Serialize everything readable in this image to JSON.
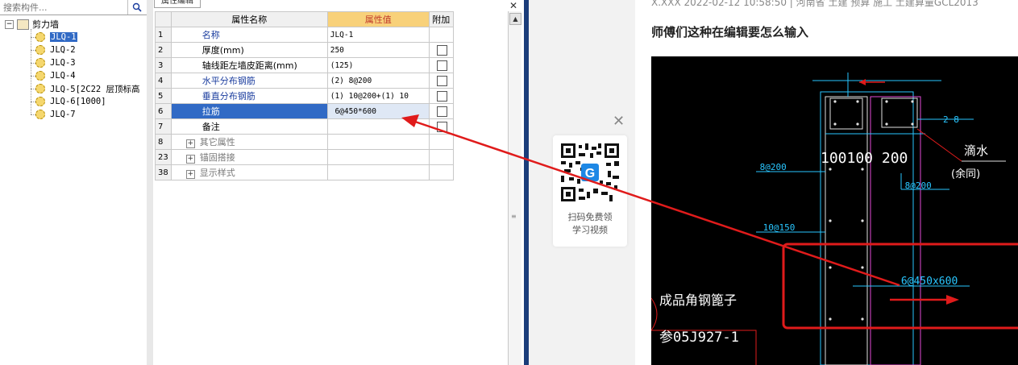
{
  "search": {
    "placeholder": "搜索构件...",
    "icon": "search-icon"
  },
  "tree": {
    "root_label": "剪力墙",
    "items": [
      {
        "label": "JLQ-1",
        "selected": true
      },
      {
        "label": "JLQ-2"
      },
      {
        "label": "JLQ-3"
      },
      {
        "label": "JLQ-4"
      },
      {
        "label": "JLQ-5[2C22 层顶标高"
      },
      {
        "label": "JLQ-6[1000]"
      },
      {
        "label": "JLQ-7"
      }
    ]
  },
  "prop_editor": {
    "tab_label": "属性编辑",
    "headers": {
      "name": "属性名称",
      "value": "属性值",
      "extra": "附加"
    },
    "rows": [
      {
        "num": "1",
        "name": "名称",
        "value": "JLQ-1",
        "style": "blue",
        "checkbox": false
      },
      {
        "num": "2",
        "name": "厚度(mm)",
        "value": "250",
        "style": "",
        "checkbox": true
      },
      {
        "num": "3",
        "name": "轴线距左墙皮距离(mm)",
        "value": "(125)",
        "style": "",
        "checkbox": true
      },
      {
        "num": "4",
        "name": "水平分布钢筋",
        "value": "(2) 8@200",
        "style": "blue",
        "checkbox": true
      },
      {
        "num": "5",
        "name": "垂直分布钢筋",
        "value": "(1) 10@200+(1) 10",
        "style": "blue",
        "checkbox": true
      },
      {
        "num": "6",
        "name": "拉筋",
        "value": " 6@450*600",
        "style": "blue",
        "checkbox": true,
        "selected": true
      },
      {
        "num": "7",
        "name": "备注",
        "value": "",
        "style": "",
        "checkbox": true
      },
      {
        "num": "8",
        "name": "其它属性",
        "value": "",
        "style": "gray",
        "checkbox": false,
        "group": true
      },
      {
        "num": "23",
        "name": "锚固搭接",
        "value": "",
        "style": "gray",
        "checkbox": false,
        "group": true
      },
      {
        "num": "38",
        "name": "显示样式",
        "value": "",
        "style": "gray",
        "checkbox": false,
        "group": true
      }
    ]
  },
  "qr_card": {
    "caption_line1": "扫码免费领",
    "caption_line2": "学习视频",
    "close_icon": "close-icon"
  },
  "post": {
    "meta": "X.XXX  2022-02-12 10:58:50  |  河南省 土建 预算 施工 土建算量GCL2013",
    "title": "师傅们这种在编辑要怎么输入"
  },
  "cad": {
    "labels": {
      "dim": "100100  200",
      "dripline": "滴水",
      "same": "(余同)",
      "rebar_top": "2 8",
      "rebar_8_200_a": " 8@200",
      "rebar_8_200_b": " 8@200",
      "rebar_10_150": " 10@150",
      "rebar_6_450": " 6@450x600",
      "product": "成品角钢篦子",
      "ref": "参05J927-1"
    }
  },
  "colors": {
    "accent": "#316ac5",
    "arrow": "#e01b1b",
    "cad_cyan": "#29c6ff",
    "cad_magenta": "#e34ad8"
  }
}
